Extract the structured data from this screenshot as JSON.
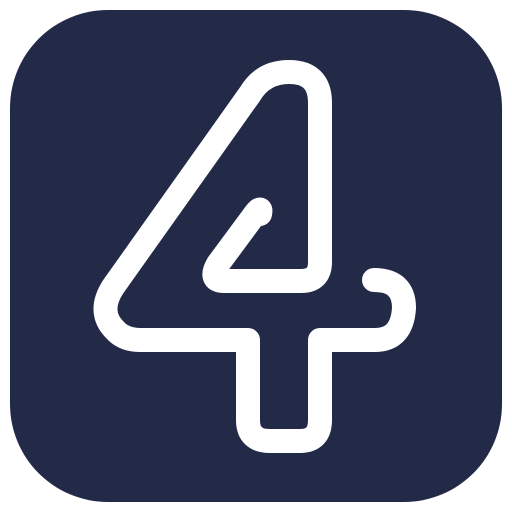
{
  "icon": {
    "name": "number-four-app-icon",
    "glyph": "4",
    "background_color": "#222a48",
    "stroke_color": "#ffffff"
  }
}
